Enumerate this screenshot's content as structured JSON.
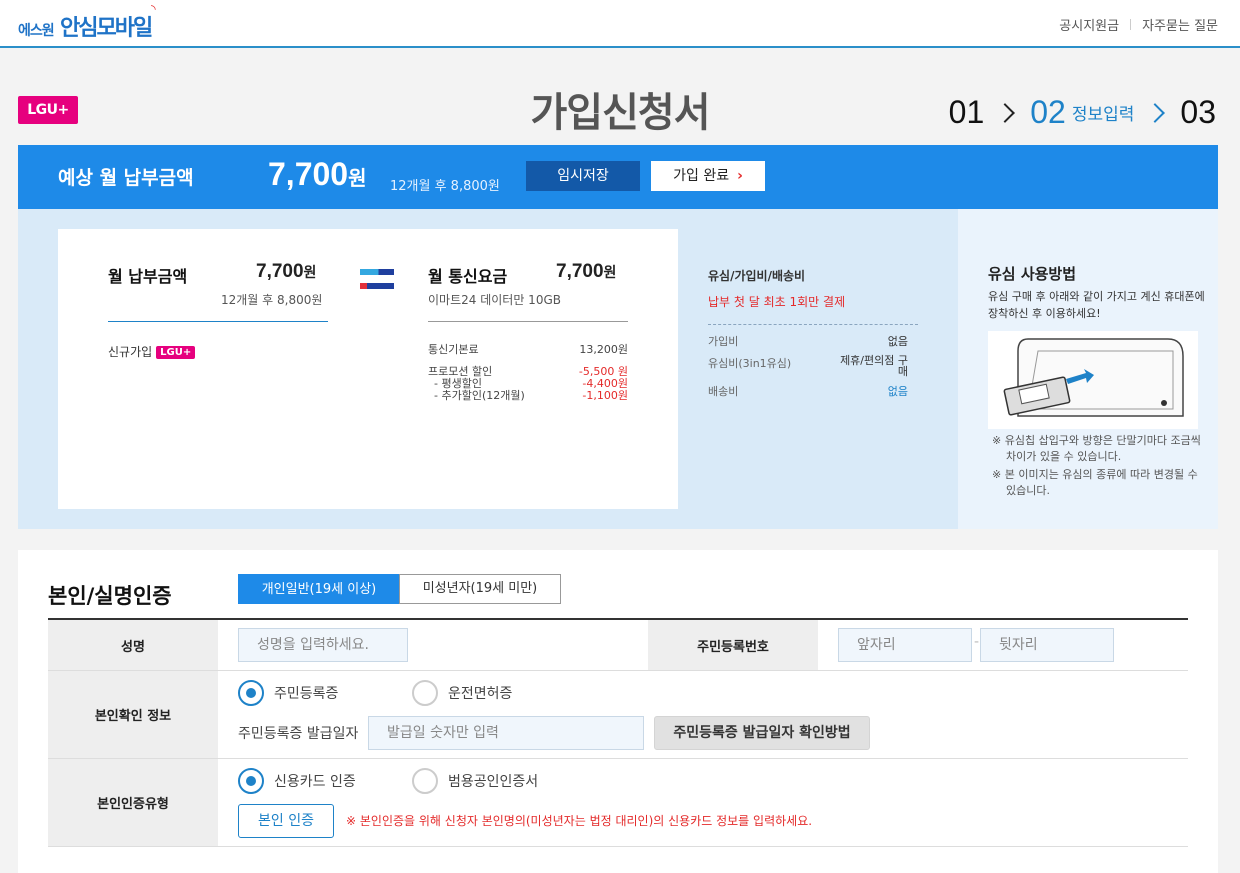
{
  "header": {
    "logo_small": "에스원",
    "logo_big": "안심모바일",
    "links": [
      "공시지원금",
      "자주묻는 질문"
    ]
  },
  "carrier_badge": "LGU+",
  "page_title": "가입신청서",
  "steps": {
    "step1": "01",
    "step2": "02",
    "step2_label": "정보입력",
    "step3": "03"
  },
  "paybar": {
    "label": "예상 월 납부금액",
    "amount": "7,700",
    "won": "원",
    "after": "12개월 후 8,800원",
    "save_button": "임시저장",
    "done_button": "가입 완료"
  },
  "summary": {
    "monthly": {
      "title": "월 납부금액",
      "value": "7,700",
      "won": "원",
      "after": "12개월 후 8,800원",
      "join_type": "신규가입",
      "badge": "LGU+"
    },
    "plan": {
      "title": "월 통신요금",
      "value": "7,700",
      "won": "원",
      "plan_name": "이마트24 데이터만 10GB",
      "rows": [
        {
          "label": "통신기본료",
          "value": "13,200원"
        },
        {
          "label": "프로모션 할인",
          "value": "-5,500 원"
        },
        {
          "label": "- 평생할인",
          "value": "-4,400원"
        },
        {
          "label": "- 추가할인(12개월)",
          "value": "-1,100원"
        }
      ]
    },
    "fees": {
      "title": "유심/가입비/배송비",
      "notice": "납부 첫 달 최초 1회만 결제",
      "rows": [
        {
          "label": "가입비",
          "value": "없음"
        },
        {
          "label": "유심비(3in1유심)",
          "value": "제휴/편의점 구매"
        },
        {
          "label": "배송비",
          "value": "없음"
        }
      ]
    }
  },
  "sim_usage": {
    "title": "유심 사용방법",
    "desc": "유심 구매 후 아래와 같이 가지고 계신 휴대폰에 장착하신 후 이용하세요!",
    "notes": [
      "※ 유심칩 삽입구와 방향은 단말기마다 조금씩 차이가 있을 수 있습니다.",
      "※ 본 이미지는 유심의 종류에 따라 변경될 수 있습니다."
    ]
  },
  "auth": {
    "title": "본인/실명인증",
    "tab_adult": "개인일반(19세 이상)",
    "tab_minor": "미성년자(19세 미만)",
    "name_label": "성명",
    "name_placeholder": "성명을 입력하세요.",
    "rrn_label": "주민등록번호",
    "rrn_front": "앞자리",
    "rrn_back": "뒷자리",
    "rrn_dash": "-",
    "id_info_label": "본인확인 정보",
    "id_option1": "주민등록증",
    "id_option2": "운전면허증",
    "issue_date_label": "주민등록증 발급일자",
    "issue_date_placeholder": "발급일 숫자만 입력",
    "issue_date_help_button": "주민등록증 발급일자 확인방법",
    "auth_type_label": "본인인증유형",
    "auth_option1": "신용카드 인증",
    "auth_option2": "범용공인인증서",
    "verify_button": "본인 인증",
    "warning": "※ 본인인증을 위해 신청자 본인명의(미성년자는 법정 대리인)의 신용카드 정보를 입력하세요."
  },
  "colors": {
    "primary": "#1e8ae8",
    "dark_blue": "#1359a8",
    "carrier_pink": "#e6007e",
    "alert_red": "#e42a2a"
  }
}
